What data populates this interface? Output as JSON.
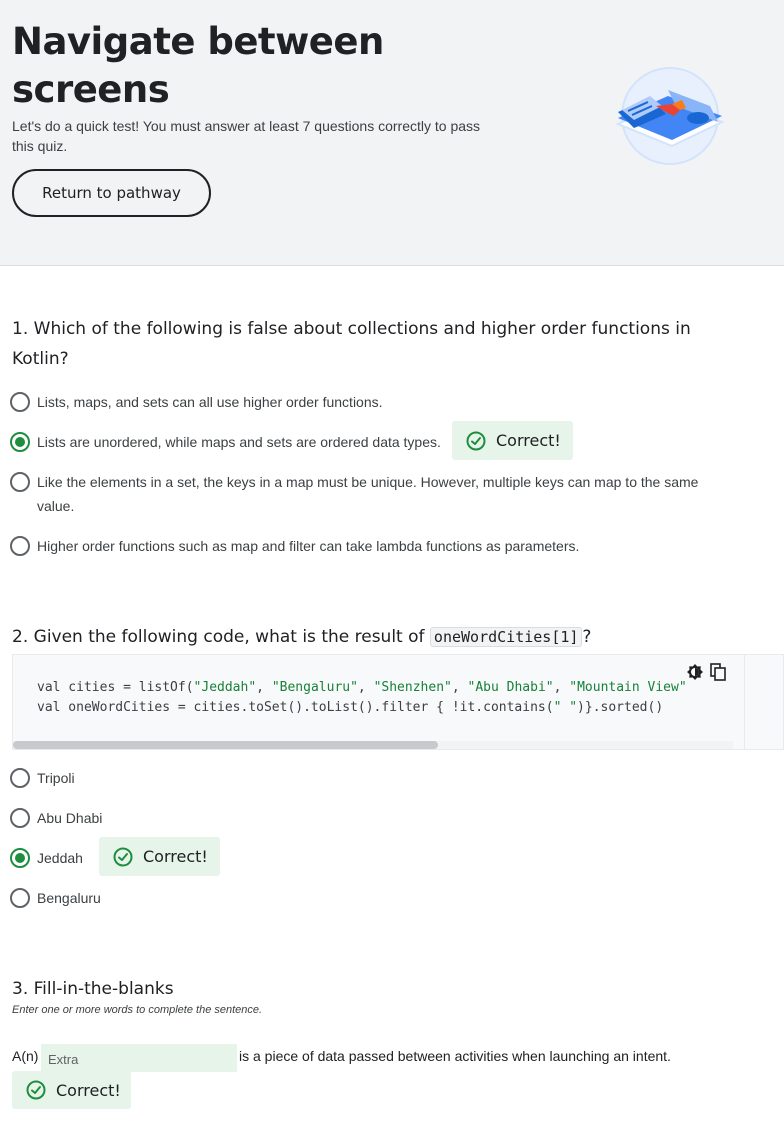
{
  "header": {
    "title": "Navigate between screens",
    "subtitle": "Let's do a quick test! You must answer at least 7 questions correctly to pass this quiz.",
    "return_button": "Return to pathway"
  },
  "questions": [
    {
      "number": "1.",
      "text": "Which of the following is false about collections and higher order functions in Kotlin?",
      "options": [
        {
          "label": "Lists, maps, and sets can all use higher order functions.",
          "selected": false
        },
        {
          "label": "Lists are unordered, while maps and sets are ordered data types.",
          "selected": true
        },
        {
          "label": "Like the elements in a set, the keys in a map must be unique. However, multiple keys can map to the same value.",
          "selected": false
        },
        {
          "label": "Higher order functions such as map and filter can take lambda functions as parameters.",
          "selected": false
        }
      ],
      "feedback": "Correct!"
    },
    {
      "number": "2.",
      "text_before": "Given the following code, what is the result of",
      "inline_code": "oneWordCities[1]",
      "text_after": "?",
      "code": {
        "line1_prefix": "val cities = listOf(",
        "line1_strings": [
          "\"Jeddah\"",
          "\"Bengaluru\"",
          "\"Shenzhen\"",
          "\"Abu Dhabi\"",
          "\"Mountain View\""
        ],
        "line1_separator": ", ",
        "line2_prefix": "val oneWordCities = cities.toSet().toList().filter { !it.contains(",
        "line2_string": "\" \"",
        "line2_suffix": ")}.sorted()"
      },
      "options": [
        {
          "label": "Tripoli",
          "selected": false
        },
        {
          "label": "Abu Dhabi",
          "selected": false
        },
        {
          "label": "Jeddah",
          "selected": true
        },
        {
          "label": "Bengaluru",
          "selected": false
        }
      ],
      "feedback": "Correct!"
    },
    {
      "number": "3.",
      "text": "Fill-in-the-blanks",
      "instruction": "Enter one or more words to complete the sentence.",
      "prefix": "A(n)",
      "answer_value": "Extra",
      "suffix": "is a piece of data passed between activities when launching an intent.",
      "feedback": "Correct!"
    }
  ],
  "colors": {
    "header_bg": "#f1f3f4",
    "correct_bg": "#e6f4ea",
    "correct_accent": "#1e8e3e",
    "code_string": "#188038"
  },
  "icons": {
    "check": "check-circle-icon",
    "theme": "dark-mode-toggle-icon",
    "copy": "copy-icon",
    "hero": "navigate-screens-illustration"
  }
}
